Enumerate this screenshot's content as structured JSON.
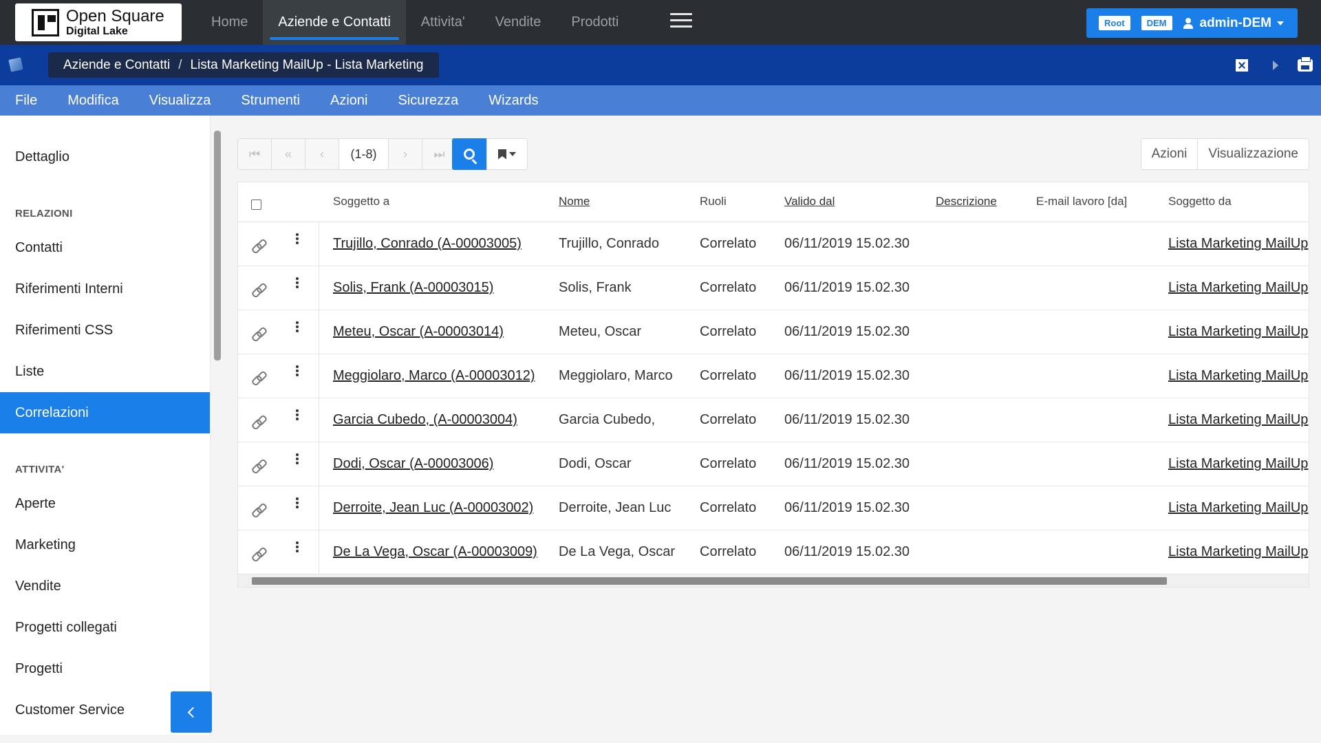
{
  "logo": {
    "line1": "Open Square",
    "line2": "Digital Lake"
  },
  "nav": {
    "items": [
      {
        "label": "Home",
        "active": false
      },
      {
        "label": "Aziende e Contatti",
        "active": true
      },
      {
        "label": "Attivita'",
        "active": false
      },
      {
        "label": "Vendite",
        "active": false
      },
      {
        "label": "Prodotti",
        "active": false
      }
    ]
  },
  "user": {
    "badge_root": "Root",
    "badge_dem": "DEM",
    "name": "admin-DEM"
  },
  "breadcrumb": {
    "part1": "Aziende e Contatti",
    "separator": "/",
    "part2": "Lista Marketing MailUp - Lista Marketing"
  },
  "menu": [
    "File",
    "Modifica",
    "Visualizza",
    "Strumenti",
    "Azioni",
    "Sicurezza",
    "Wizards"
  ],
  "sidebar": {
    "detail": "Dettaglio",
    "section_relazioni": "RELAZIONI",
    "relazioni": [
      "Contatti",
      "Riferimenti Interni",
      "Riferimenti CSS",
      "Liste",
      "Correlazioni"
    ],
    "section_attivita": "ATTIVITA'",
    "attivita": [
      "Aperte",
      "Marketing",
      "Vendite",
      "Progetti collegati",
      "Progetti",
      "Customer Service"
    ],
    "active": "Correlazioni"
  },
  "pager": {
    "count": "(1-8)"
  },
  "actions": {
    "azioni": "Azioni",
    "visualizzazione": "Visualizzazione"
  },
  "table": {
    "headers": {
      "soggetto_a": "Soggetto a",
      "nome": "Nome",
      "ruoli": "Ruoli",
      "valido_dal": "Valido dal",
      "descrizione": "Descrizione",
      "email": "E-mail lavoro [da]",
      "soggetto_da": "Soggetto da"
    },
    "rows": [
      {
        "soggetto_a": "Trujillo, Conrado (A-00003005)",
        "nome": "Trujillo, Conrado",
        "ruoli": "Correlato",
        "valido_dal": "06/11/2019 15.02.30",
        "soggetto_da": "Lista Marketing MailUp"
      },
      {
        "soggetto_a": "Solis, Frank (A-00003015)",
        "nome": "Solis, Frank",
        "ruoli": "Correlato",
        "valido_dal": "06/11/2019 15.02.30",
        "soggetto_da": "Lista Marketing MailUp"
      },
      {
        "soggetto_a": "Meteu, Oscar (A-00003014)",
        "nome": "Meteu, Oscar",
        "ruoli": "Correlato",
        "valido_dal": "06/11/2019 15.02.30",
        "soggetto_da": "Lista Marketing MailUp"
      },
      {
        "soggetto_a": "Meggiolaro, Marco (A-00003012)",
        "nome": "Meggiolaro, Marco",
        "ruoli": "Correlato",
        "valido_dal": "06/11/2019 15.02.30",
        "soggetto_da": "Lista Marketing MailUp"
      },
      {
        "soggetto_a": "Garcia Cubedo, (A-00003004)",
        "nome": "Garcia Cubedo,",
        "ruoli": "Correlato",
        "valido_dal": "06/11/2019 15.02.30",
        "soggetto_da": "Lista Marketing MailUp"
      },
      {
        "soggetto_a": "Dodi, Oscar (A-00003006)",
        "nome": "Dodi, Oscar",
        "ruoli": "Correlato",
        "valido_dal": "06/11/2019 15.02.30",
        "soggetto_da": "Lista Marketing MailUp"
      },
      {
        "soggetto_a": "Derroite, Jean Luc (A-00003002)",
        "nome": "Derroite, Jean Luc",
        "ruoli": "Correlato",
        "valido_dal": "06/11/2019 15.02.30",
        "soggetto_da": "Lista Marketing MailUp"
      },
      {
        "soggetto_a": "De La Vega, Oscar (A-00003009)",
        "nome": "De La Vega, Oscar",
        "ruoli": "Correlato",
        "valido_dal": "06/11/2019 15.02.30",
        "soggetto_da": "Lista Marketing MailUp"
      }
    ]
  },
  "colors": {
    "primary": "#1a7fe8",
    "topbar": "#2b2f33",
    "crumbbar": "#0d3d9c",
    "menubar": "#4a7fd6"
  }
}
